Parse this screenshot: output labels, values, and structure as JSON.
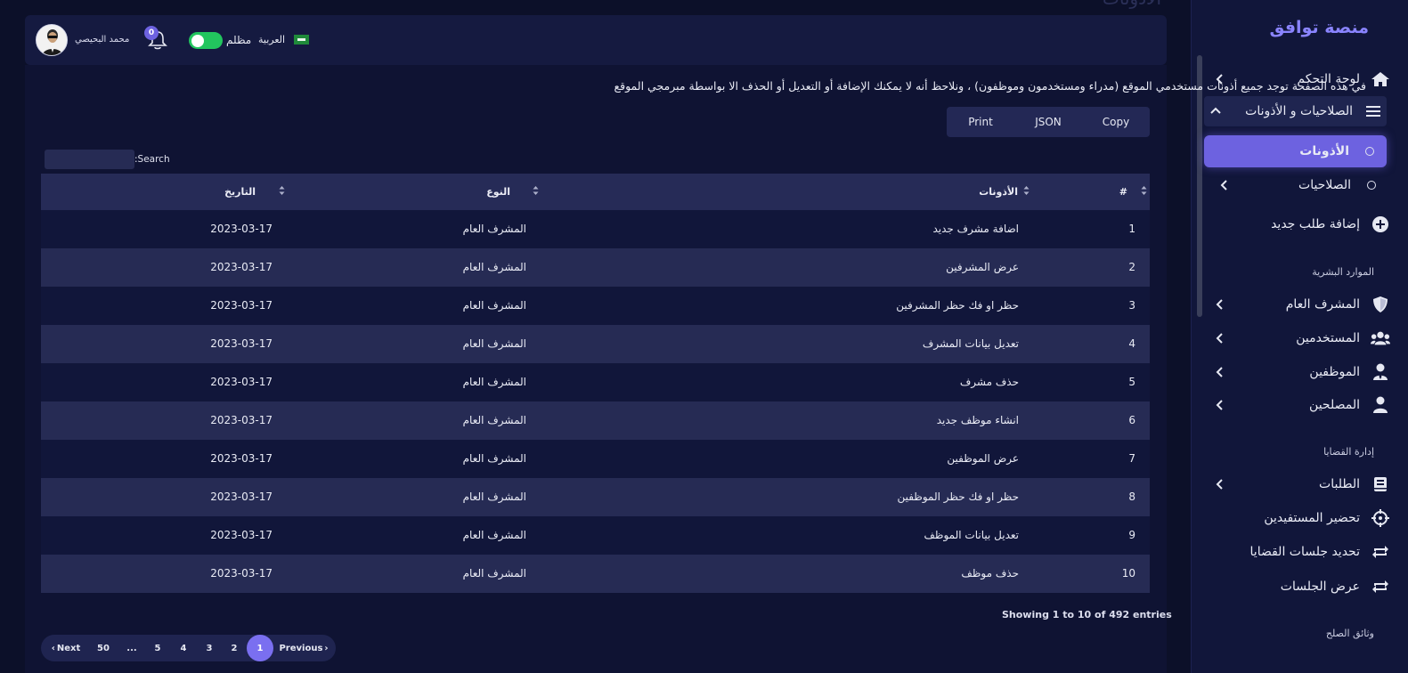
{
  "sidebar": {
    "brand": "منصة توافق",
    "items": [
      {
        "label": "لوحة التحكم",
        "icon": "home-icon"
      },
      {
        "label": "الصلاحيات و الأذونات",
        "icon": "menu-icon"
      },
      {
        "label": "الأذونات",
        "icon": "circle-icon"
      },
      {
        "label": "الصلاحيات",
        "icon": "circle-icon"
      },
      {
        "label": "إضافة طلب جديد",
        "icon": "plus-circle-icon"
      },
      {
        "label": "المشرف العام",
        "icon": "shield-icon"
      },
      {
        "label": "المستخدمين",
        "icon": "users-icon"
      },
      {
        "label": "الموظفين",
        "icon": "user-tie-icon"
      },
      {
        "label": "المصلحين",
        "icon": "user-icon"
      },
      {
        "label": "الطلبات",
        "icon": "book-icon"
      },
      {
        "label": "تحضير المستفيدين",
        "icon": "crosshair-icon"
      },
      {
        "label": "تحديد جلسات القضايا",
        "icon": "repeat-icon"
      },
      {
        "label": "عرض الجلسات",
        "icon": "repeat-icon"
      }
    ],
    "sections": {
      "hr": "الموارد البشرية",
      "cases": "إدارة القضايا",
      "docs": "وثائق الصلح"
    }
  },
  "header": {
    "ghost_title": "الأذونات",
    "user_name": "محمد البحيصي",
    "notifications": "0",
    "dark_label": "مظلم",
    "language": "العربية"
  },
  "main": {
    "intro": "في هذه الصفحة توجد جميع أذونات مستخدمي الموقع (مدراء ومستخدمون وموظفون) ، ونلاحظ أنه لا يمكنك الإضافة أو التعديل أو الحذف الا بواسطة مبرمجي الموقع",
    "buttons": {
      "print": "Print",
      "json": "JSON",
      "copy": "Copy"
    },
    "search_label": ":Search",
    "columns": {
      "num": "#",
      "permission": "الأذونات",
      "type": "النوع",
      "date": "التاريخ"
    },
    "rows": [
      {
        "num": "1",
        "permission": "اضافة مشرف جديد",
        "type": "المشرف العام",
        "date": "2023-03-17"
      },
      {
        "num": "2",
        "permission": "عرض المشرفين",
        "type": "المشرف العام",
        "date": "2023-03-17"
      },
      {
        "num": "3",
        "permission": "حظر او فك حظر المشرفين",
        "type": "المشرف العام",
        "date": "2023-03-17"
      },
      {
        "num": "4",
        "permission": "تعديل بيانات المشرف",
        "type": "المشرف العام",
        "date": "2023-03-17"
      },
      {
        "num": "5",
        "permission": "حذف مشرف",
        "type": "المشرف العام",
        "date": "2023-03-17"
      },
      {
        "num": "6",
        "permission": "انشاء موظف جديد",
        "type": "المشرف العام",
        "date": "2023-03-17"
      },
      {
        "num": "7",
        "permission": "عرض الموظفين",
        "type": "المشرف العام",
        "date": "2023-03-17"
      },
      {
        "num": "8",
        "permission": "حظر او فك حظر الموظفين",
        "type": "المشرف العام",
        "date": "2023-03-17"
      },
      {
        "num": "9",
        "permission": "تعديل بيانات الموظف",
        "type": "المشرف العام",
        "date": "2023-03-17"
      },
      {
        "num": "10",
        "permission": "حذف موظف",
        "type": "المشرف العام",
        "date": "2023-03-17"
      }
    ],
    "info": "Showing 1 to 10 of 492 entries",
    "pagination": {
      "next": "Next",
      "pages": [
        "50",
        "...",
        "5",
        "4",
        "3",
        "2",
        "1"
      ],
      "previous": "Previous"
    }
  },
  "colors": {
    "accent": "#6d62e0",
    "brand": "#8a84ff",
    "toggle_on": "#22c55e",
    "sidebar_bg": "#11163a",
    "page_bg": "#0c1029"
  }
}
